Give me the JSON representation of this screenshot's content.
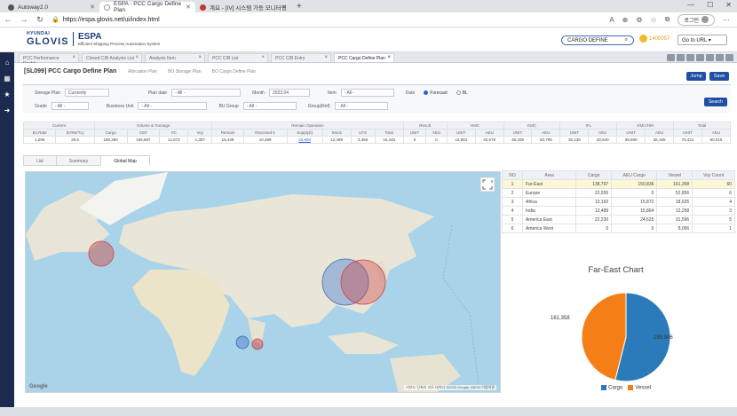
{
  "browser": {
    "tabs": [
      {
        "label": "Autoway2.0",
        "active": false
      },
      {
        "label": "ESPA - PCC Cargo Define Plan",
        "active": true
      },
      {
        "label": "계요 - [IV] 시스템 가동 모니터링",
        "active": false
      }
    ],
    "url": "https://espa.glovis.net/ui/index.html",
    "login_label": "로그인"
  },
  "app": {
    "logo_top": "HYUNDAI",
    "logo_main": "GLOVIS",
    "brand_title": "ESPA",
    "brand_subtitle": "Efficient Shipping Process Automation System",
    "search_value": "CARGO DEFINE",
    "notification_count": "1400057",
    "go_to_url_label": "Go to URL"
  },
  "page_tabs": [
    {
      "label": "PCC Performance Dashb...",
      "active": false
    },
    {
      "label": "Closed C/B Analysis List",
      "active": false
    },
    {
      "label": "Analysis Item",
      "active": false
    },
    {
      "label": "PCC C/B List",
      "active": false
    },
    {
      "label": "PCC C/B Entry",
      "active": false
    },
    {
      "label": "PCC Cargo Define Plan",
      "active": true
    }
  ],
  "page": {
    "title": "[SL099] PCC Cargo Define Plan",
    "breadcrumbs": [
      "Allocation Plan",
      "BO Storage Plan",
      "BO Cargo Define Plan"
    ],
    "jump_label": "Jump",
    "save_label": "Save",
    "search_label": "Search"
  },
  "filters": {
    "storage_plan_label": "Storage Plan",
    "storage_plan_value": "Currently",
    "plan_date_label": "Plan date",
    "plan_date_value": "- All -",
    "month_label": "Month",
    "month_value": "2023.04",
    "item_label": "Item",
    "item_value": "- All -",
    "date_label": "Date",
    "forecast_label": "Forecast",
    "bl_label": "BL",
    "grade_label": "Grade",
    "grade_value": "- All -",
    "business_unit_label": "Business Unit",
    "business_unit_value": "- All -",
    "bu_group_label": "BU Group",
    "bu_group_value": "- All -",
    "group_ref_label": "Group(Ref)",
    "group_ref_value": "- All -"
  },
  "summary": {
    "group_headers": [
      "Current",
      "Volume & Tonnage",
      "Remain Operation",
      "Result",
      "HMC",
      "KMC",
      "IFL",
      "KMC/HM",
      "Total"
    ],
    "sub_headers": [
      "Ex.Rate",
      "(KRW/TL)",
      "Cargo",
      "CBT",
      "VC",
      "Voy",
      "Remain",
      "Received-1",
      "Supply(t)",
      "Stock",
      "UTS",
      "Total",
      "UNIT",
      "AEU",
      "UNIT",
      "AEU",
      "UNIT",
      "AEU",
      "UNIT",
      "AEU",
      "UNIT",
      "AEU",
      "UNIT",
      "AEU"
    ],
    "values": [
      "1,295",
      "25.5",
      "180,360",
      "165,687",
      "12,673",
      "1,357",
      "15,448",
      "10,489",
      "22,603",
      "12,489",
      "3,355",
      "15,448",
      "0",
      "0",
      "42,803",
      "40,679",
      "48,208",
      "50,796",
      "30,139",
      "30,540",
      "35,680",
      "36,165",
      "75,421",
      "80,015"
    ]
  },
  "view_tabs": [
    "List",
    "Summary",
    "Global Map"
  ],
  "map": {
    "attribution": "Google",
    "copyright": "키보드 단축키  지도 데이터 ©2023 Google, INEGI  이용약관"
  },
  "grid": {
    "headers": [
      "NO",
      "Area",
      "Cargo",
      "AEU Cargo",
      "Vessel",
      "Voy Count"
    ],
    "rows": [
      [
        "1",
        "Far-East",
        "138,797",
        "150,836",
        "161,358",
        "60"
      ],
      [
        "2",
        "Europe",
        "22,555",
        "0",
        "52,856",
        "6"
      ],
      [
        "3",
        "Africa",
        "13,192",
        "15,872",
        "18,625",
        "4"
      ],
      [
        "4",
        "India",
        "13,489",
        "15,864",
        "12,258",
        "3"
      ],
      [
        "5",
        "America East",
        "22,230",
        "24,625",
        "31,596",
        "5"
      ],
      [
        "6",
        "America West",
        "0",
        "0",
        "8,056",
        "1"
      ]
    ]
  },
  "chart_data": {
    "type": "pie",
    "title": "Far-East Chart",
    "categories": [
      "Cargo",
      "Vessel"
    ],
    "values": [
      188,
      906,
      161,
      358
    ],
    "colors": [
      "#2b7bba",
      "#f57f17"
    ],
    "legend_position": "bottom"
  }
}
